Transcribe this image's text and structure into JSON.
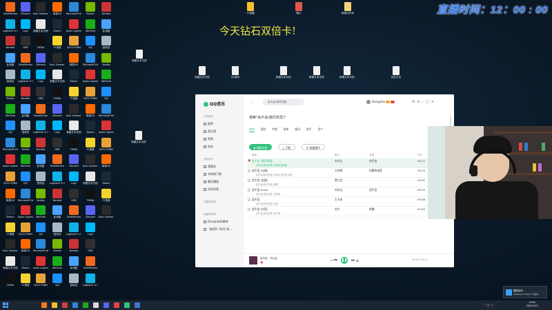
{
  "overlay": {
    "live_time": "直播时间：12：00 : 00",
    "promo_text": "今天钻石双倍卡!"
  },
  "desktop_icons": [
    {
      "label": "SteelSeries",
      "color": "#f06a1d"
    },
    {
      "label": "Logitech G HUB",
      "color": "#0fb3e8"
    },
    {
      "label": "Naraka",
      "color": "#c33"
    },
    {
      "label": "此电脑",
      "color": "#4aa3ff"
    },
    {
      "label": "回收站",
      "color": "#a8b8c8"
    },
    {
      "label": "Nvidia",
      "color": "#76b900"
    },
    {
      "label": "WeChat",
      "color": "#1aad19"
    },
    {
      "label": "QQ",
      "color": "#1e90ff"
    },
    {
      "label": "Microsoft Edge",
      "color": "#2c88d9"
    },
    {
      "label": "Apex Legends",
      "color": "#d33"
    },
    {
      "label": "2022 PUBG",
      "color": "#e8a23a"
    },
    {
      "label": "网易UU",
      "color": "#ff6a00"
    },
    {
      "label": "Steam",
      "color": "#1b2838"
    },
    {
      "label": "YY语音",
      "color": "#f6d32d"
    },
    {
      "label": "Epic Games Launcher",
      "color": "#2a2a2a"
    },
    {
      "label": "新建文本文档",
      "color": "#e8e8e8"
    },
    {
      "label": "TikTok",
      "color": "#111"
    },
    {
      "label": "Discord",
      "color": "#5865f2"
    },
    {
      "label": "Logi",
      "color": "#00b8fc"
    },
    {
      "label": "OBS",
      "color": "#302e31"
    }
  ],
  "top_files": [
    {
      "label": "YY直播"
    },
    {
      "label": "图片"
    },
    {
      "label": "新建文件夹"
    }
  ],
  "mid_files": [
    {
      "label": "新建文本文档"
    },
    {
      "label": "QQ音乐"
    },
    {
      "label": "新建文本文档 (2)"
    },
    {
      "label": "新建文本文档 (3)"
    },
    {
      "label": "新建文本文档 (4)"
    },
    {
      "label": "钻石日志"
    }
  ],
  "qqmusic": {
    "logo": "QQ音乐",
    "search_text": "会不会(我们的爱)",
    "user": "Dongyibo",
    "nav_sections": [
      {
        "title": "在线音乐",
        "items": [
          "推荐",
          "音乐馆",
          "视频",
          "电台"
        ]
      },
      {
        "title": "我的音乐",
        "items": [
          "我喜欢",
          "本地和下载",
          "最近播放",
          "试听列表"
        ]
      },
      {
        "title": "创建的歌单",
        "items": []
      },
      {
        "title": "收藏的歌单",
        "items": [
          "DongLab的歌单",
          "【推荐】2022 热..."
        ]
      }
    ],
    "page_title": "搜索\"会不会(我们的爱)\"",
    "tabs": [
      "单曲",
      "视频",
      "专辑",
      "歌单",
      "歌词",
      "歌手",
      "用户"
    ],
    "actions": {
      "play_all": "播放全部",
      "download": "下载",
      "batch": "批量操作"
    },
    "columns": {
      "song": "歌曲",
      "artist": "歌手",
      "album": "专辑",
      "duration": "时长"
    },
    "rows": [
      {
        "title": "会不会 (我们的爱)",
        "sub": "会不会(我们的爱) 会是永远的爱",
        "artist": "刘大壮",
        "album": "会不会",
        "duration": "04:17",
        "liked": true
      },
      {
        "title": "会不会 (DJ版)",
        "sub": "会不会(我们的爱) 会是永远的爱 DJ版",
        "artist": "大伟哥",
        "album": "阿雅的电音",
        "duration": "03:29",
        "liked": false
      },
      {
        "title": "会不会 (女版)",
        "sub": "会不会(我们的爱) 翻唱",
        "artist": "是以空",
        "album": "",
        "duration": "04:02",
        "liked": false
      },
      {
        "title": "会不会 (Live)",
        "sub": "会不会(我们的爱) 现场版",
        "artist": "刘大壮",
        "album": "会不会",
        "duration": "04:25",
        "liked": false
      },
      {
        "title": "会不会",
        "sub": "会不会(我们的爱) 伴奏",
        "artist": "王大毛",
        "album": "",
        "duration": "03:58",
        "liked": false
      },
      {
        "title": "会不会 (抖音)",
        "sub": "会不会(我们的爱) 热门版",
        "artist": "刘大",
        "album": "热播",
        "duration": "03:40",
        "liked": false
      }
    ],
    "player": {
      "title": "会不会 - 刘大壮",
      "time": "00:05 / 04:17"
    }
  },
  "taskbar": {
    "clock_time": "19:02",
    "clock_date": "2022/1/21"
  },
  "notification": {
    "title": "壁纸启动",
    "body": "Wallpaper Engine 已启动"
  }
}
